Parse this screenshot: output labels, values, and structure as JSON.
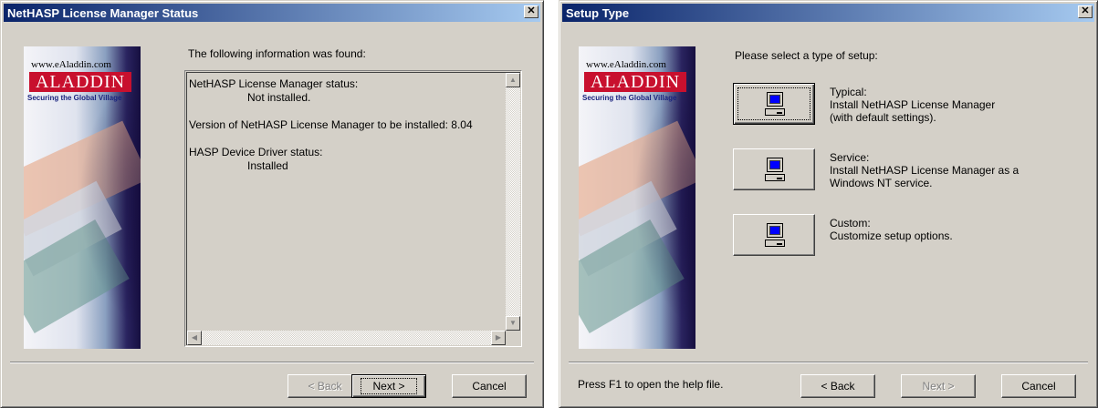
{
  "windows": [
    {
      "title": "NetHASP License Manager Status",
      "banner": {
        "url": "www.eAladdin.com",
        "brand": "ALADDIN",
        "slogan": "Securing the Global Village"
      },
      "heading": "The following information was found:",
      "info": {
        "status_label": "NetHASP License Manager status:",
        "status_value": "Not installed.",
        "version_line": "Version of NetHASP License Manager to be installed:  8.04",
        "driver_label": "HASP Device Driver status:",
        "driver_value": "Installed"
      },
      "buttons": {
        "back": "< Back",
        "next": "Next >",
        "cancel": "Cancel"
      }
    },
    {
      "title": "Setup Type",
      "banner": {
        "url": "www.eAladdin.com",
        "brand": "ALADDIN",
        "slogan": "Securing the Global Village"
      },
      "heading": "Please select a type of setup:",
      "options": [
        {
          "name": "Typical:",
          "lines": [
            "Install NetHASP License Manager",
            "(with default settings)."
          ]
        },
        {
          "name": "Service:",
          "lines": [
            "Install NetHASP License Manager as a",
            "Windows NT service."
          ]
        },
        {
          "name": "Custom:",
          "lines": [
            "Customize setup options."
          ]
        }
      ],
      "help_text": "Press F1 to open the help file.",
      "buttons": {
        "back": "< Back",
        "next": "Next >",
        "cancel": "Cancel"
      }
    }
  ],
  "icons": {
    "close": "close-icon",
    "computer": "computer-icon",
    "scroll_up": "arrow-up-icon",
    "scroll_down": "arrow-down-icon",
    "scroll_left": "arrow-left-icon",
    "scroll_right": "arrow-right-icon"
  },
  "colors": {
    "titlebar_start": "#0a246a",
    "titlebar_end": "#a6caf0",
    "face": "#d4d0c8",
    "brand_red": "#c8102e",
    "screen_blue": "#0000ff"
  }
}
